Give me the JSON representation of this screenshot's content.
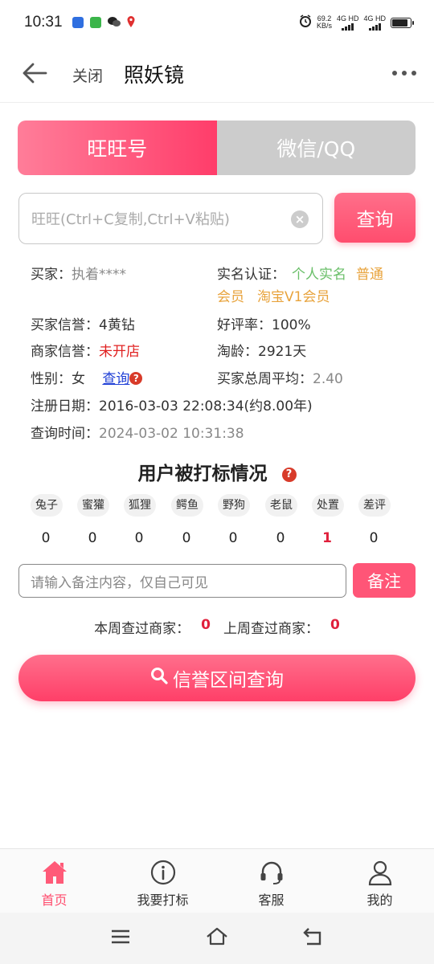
{
  "status_bar": {
    "time": "10:31",
    "net_speed": "69.2",
    "net_unit": "KB/s",
    "sim1": "4G HD",
    "sim2": "4G HD",
    "app_icons": [
      "blue-app-icon",
      "green-app-icon",
      "wechat-icon",
      "location-icon"
    ]
  },
  "nav": {
    "close_label": "关闭",
    "title": "照妖镜"
  },
  "tabs": [
    {
      "label": "旺旺号",
      "active": true
    },
    {
      "label": "微信/QQ",
      "active": false
    }
  ],
  "search": {
    "placeholder": "旺旺(Ctrl+C复制,Ctrl+V粘贴)",
    "button_label": "查询"
  },
  "info": {
    "buyer_label": "买家：",
    "buyer_value": "执着****",
    "realname_label": "实名认证：",
    "realname_value": "个人实名",
    "member_value_1": "普通",
    "member_value_2": "会员",
    "taobao_value": "淘宝V1会员",
    "buyer_credit_label": "买家信誉：",
    "buyer_credit_value": "4黄钻",
    "praise_label": "好评率：",
    "praise_value": "100%",
    "merchant_credit_label": "商家信誉：",
    "merchant_credit_value": "未开店",
    "taoling_label": "淘龄：",
    "taoling_value": "2921天",
    "gender_label": "性别：",
    "gender_value": "女",
    "gender_query_link": "查询",
    "weekly_avg_label": "买家总周平均：",
    "weekly_avg_value": "2.40",
    "register_label": "注册日期：",
    "register_value": "2016-03-03 22:08:34(约8.00年)",
    "query_time_label": "查询时间：",
    "query_time_value": "2024-03-02 10:31:38"
  },
  "marks": {
    "title": "用户被打标情况",
    "items": [
      {
        "label": "兔子",
        "count": "0"
      },
      {
        "label": "蜜獾",
        "count": "0"
      },
      {
        "label": "狐狸",
        "count": "0"
      },
      {
        "label": "鳄鱼",
        "count": "0"
      },
      {
        "label": "野狗",
        "count": "0"
      },
      {
        "label": "老鼠",
        "count": "0"
      },
      {
        "label": "处置",
        "count": "1"
      },
      {
        "label": "差评",
        "count": "0"
      }
    ]
  },
  "note": {
    "placeholder": "请输入备注内容，仅自己可见",
    "button_label": "备注"
  },
  "merchant_stats": {
    "this_week_label": "本周查过商家：",
    "this_week_value": "0",
    "last_week_label": "上周查过商家：",
    "last_week_value": "0"
  },
  "credit_button_label": "信誉区间查询",
  "bottom_nav": [
    {
      "label": "首页",
      "icon": "home-icon",
      "active": true
    },
    {
      "label": "我要打标",
      "icon": "info-icon",
      "active": false
    },
    {
      "label": "客服",
      "icon": "headset-icon",
      "active": false
    },
    {
      "label": "我的",
      "icon": "user-icon",
      "active": false
    }
  ],
  "colors": {
    "accent": "#ff4d6e",
    "tab_inactive": "#cccccc",
    "danger_text": "#e02020",
    "green_text": "#6abf69",
    "orange_text": "#e8a33c"
  }
}
